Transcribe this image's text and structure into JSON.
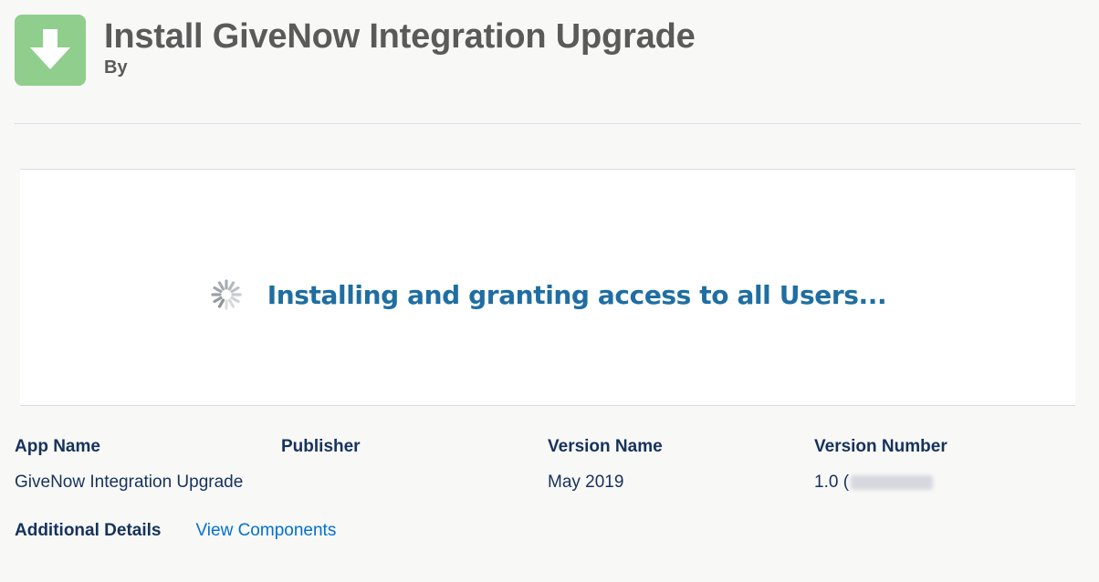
{
  "header": {
    "title": "Install GiveNow Integration Upgrade",
    "by_label": "By",
    "icon": "download-arrow-icon",
    "icon_color": "#8fce8d"
  },
  "progress": {
    "message": "Installing and granting access to all Users...",
    "spinner_icon": "loading-spinner-icon",
    "text_color": "#1f6ea2"
  },
  "details": {
    "app_name_label": "App Name",
    "app_name_value": "GiveNow Integration Upgrade",
    "publisher_label": "Publisher",
    "publisher_value": "",
    "version_name_label": "Version Name",
    "version_name_value": "May 2019",
    "version_number_label": "Version Number",
    "version_number_prefix": "1.0 ("
  },
  "additional": {
    "label": "Additional Details",
    "view_components_link": "View Components",
    "link_color": "#0070d2"
  }
}
